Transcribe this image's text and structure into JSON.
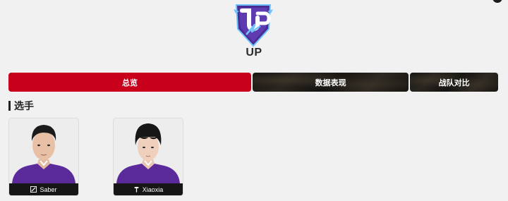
{
  "team": {
    "name": "UP",
    "logo_icon": "up-team-logo-icon",
    "colors": {
      "primary": "#5b2fa3",
      "accent": "#43a3ff"
    }
  },
  "tabs": [
    {
      "label": "总览",
      "active": true
    },
    {
      "label": "数据表现",
      "active": false
    },
    {
      "label": "战队对比",
      "active": false
    }
  ],
  "section": {
    "title": "选手"
  },
  "players": [
    {
      "name": "Saber",
      "role_icon": "solo-lane-icon"
    },
    {
      "name": "Xiaoxia",
      "role_icon": "support-icon"
    }
  ],
  "colors": {
    "active_tab": "#c8001b",
    "background": "#f2f1f1"
  }
}
